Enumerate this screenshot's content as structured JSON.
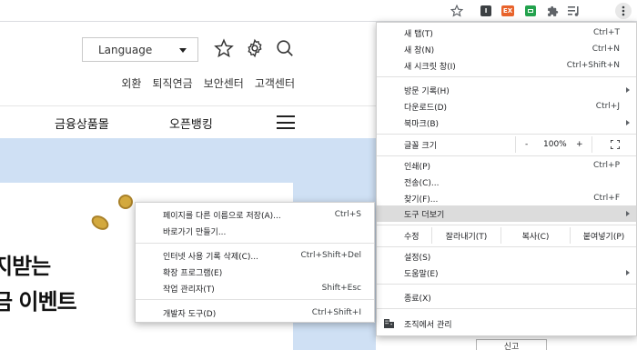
{
  "toolbar": {
    "ext_ex_label": "EX"
  },
  "page": {
    "language_select": "Language",
    "util_nav": [
      "외환",
      "퇴직연금",
      "보안센터",
      "고객센터"
    ],
    "main_nav": [
      "금융상품몰",
      "오픈뱅킹"
    ],
    "banner_line1": "지받는",
    "banner_line2": "금 이벤트",
    "bottom_button": "신고"
  },
  "chrome_menu": {
    "new_tab": {
      "label": "새 탭(T)",
      "shortcut": "Ctrl+T"
    },
    "new_window": {
      "label": "새 창(N)",
      "shortcut": "Ctrl+N"
    },
    "new_incognito": {
      "label": "새 시크릿 창(I)",
      "shortcut": "Ctrl+Shift+N"
    },
    "history": {
      "label": "방문 기록(H)"
    },
    "downloads": {
      "label": "다운로드(D)",
      "shortcut": "Ctrl+J"
    },
    "bookmarks": {
      "label": "북마크(B)"
    },
    "zoom": {
      "label": "글꼴 크기",
      "minus": "-",
      "value": "100%",
      "plus": "+"
    },
    "print": {
      "label": "인쇄(P)",
      "shortcut": "Ctrl+P"
    },
    "cast": {
      "label": "전송(C)..."
    },
    "find": {
      "label": "찾기(F)...",
      "shortcut": "Ctrl+F"
    },
    "more_tools": {
      "label": "도구 더보기"
    },
    "edit": {
      "label": "수정",
      "cut": "잘라내기(T)",
      "copy": "복사(C)",
      "paste": "붙여넣기(P)"
    },
    "settings": {
      "label": "설정(S)"
    },
    "help": {
      "label": "도움말(E)"
    },
    "exit": {
      "label": "종료(X)"
    },
    "managed": {
      "label": "조직에서 관리"
    }
  },
  "sub_menu": {
    "save_page": {
      "label": "페이지를 다른 이름으로 저장(A)...",
      "shortcut": "Ctrl+S"
    },
    "create_shortcut": {
      "label": "바로가기 만들기..."
    },
    "clear_data": {
      "label": "인터넷 사용 기록 삭제(C)...",
      "shortcut": "Ctrl+Shift+Del"
    },
    "extensions": {
      "label": "확장 프로그램(E)"
    },
    "task_manager": {
      "label": "작업 관리자(T)",
      "shortcut": "Shift+Esc"
    },
    "dev_tools": {
      "label": "개발자 도구(D)",
      "shortcut": "Ctrl+Shift+I"
    }
  }
}
